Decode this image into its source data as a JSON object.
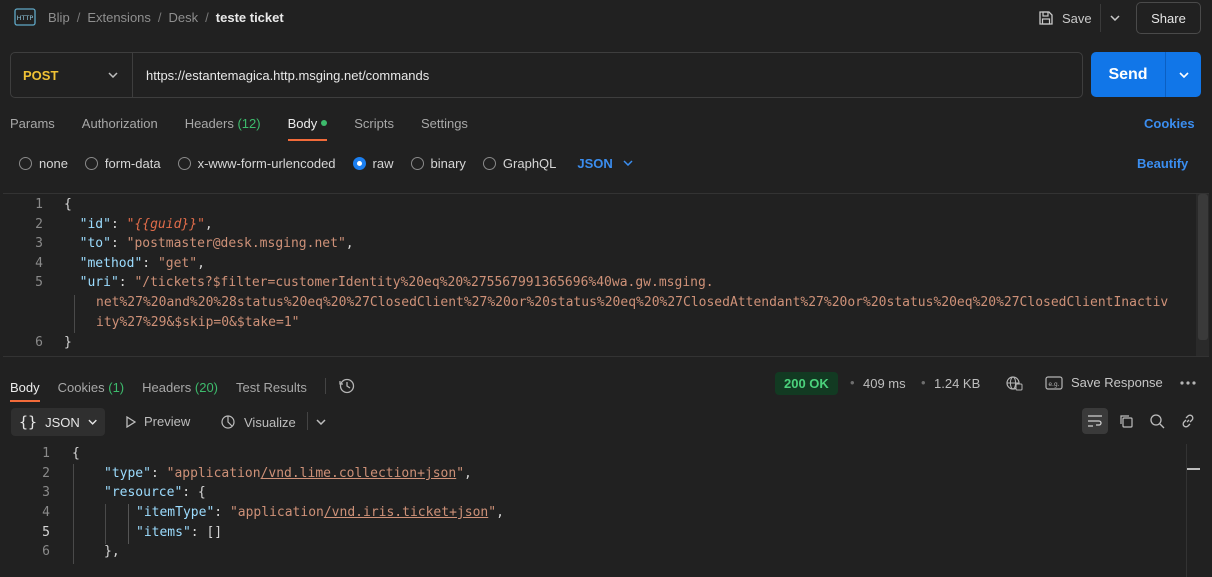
{
  "header": {
    "breadcrumbs": [
      "Blip",
      "Extensions",
      "Desk"
    ],
    "current": "teste ticket",
    "save_label": "Save",
    "share_label": "Share"
  },
  "request": {
    "method": "POST",
    "url": "https://estantemagica.http.msging.net/commands",
    "send_label": "Send"
  },
  "req_tabs": [
    {
      "label": "Params"
    },
    {
      "label": "Authorization"
    },
    {
      "label": "Headers",
      "count": "(12)"
    },
    {
      "label": "Body",
      "active": true
    },
    {
      "label": "Scripts"
    },
    {
      "label": "Settings"
    }
  ],
  "cookies_link": "Cookies",
  "body_types": {
    "none": "none",
    "form_data": "form-data",
    "urlencoded": "x-www-form-urlencoded",
    "raw": "raw",
    "binary": "binary",
    "graphql": "GraphQL",
    "format": "JSON",
    "selected": "raw"
  },
  "beautify_label": "Beautify",
  "request_body": {
    "line_numbers": [
      "1",
      "2",
      "3",
      "4",
      "5",
      "6"
    ],
    "open_brace": "{",
    "close_brace": "}",
    "id_key": "\"id\"",
    "id_value": "\"{{guid}}\"",
    "to_key": "\"to\"",
    "to_value": "\"postmaster@desk.msging.net\"",
    "method_key": "\"method\"",
    "method_value": "\"get\"",
    "uri_key": "\"uri\"",
    "uri_value_1": "\"/tickets?$filter=customerIdentity%20eq%20%275567991365696%40wa.gw.msging.",
    "uri_value_2": "net%27%20and%20%28status%20eq%20%27ClosedClient%27%20or%20status%20eq%20%27ClosedAttendant%27%20or%20status%20eq%20%27ClosedClientInactiv",
    "uri_value_3": "ity%27%29&$skip=0&$take=1\""
  },
  "res_tabs": {
    "body": "Body",
    "cookies": "Cookies",
    "cookies_count": "(1)",
    "headers": "Headers",
    "headers_count": "(20)",
    "test_results": "Test Results"
  },
  "response_meta": {
    "status": "200 OK",
    "time": "409 ms",
    "size": "1.24 KB",
    "save_response": "Save Response"
  },
  "response_toolbar": {
    "format": "JSON",
    "preview": "Preview",
    "visualize": "Visualize"
  },
  "response_body": {
    "line_numbers": [
      "1",
      "2",
      "3",
      "4",
      "5",
      "6"
    ],
    "open_brace": "{",
    "type_key": "\"type\"",
    "type_value_a": "\"application",
    "type_value_b": "/vnd.lime.collection+json",
    "type_value_c": "\"",
    "resource_key": "\"resource\"",
    "item_type_key": "\"itemType\"",
    "item_type_value_a": "\"application",
    "item_type_value_b": "/vnd.iris.ticket+json",
    "item_type_value_c": "\"",
    "items_key": "\"items\"",
    "items_value": "[]",
    "close_resource": "},"
  },
  "colors": {
    "accent_blue": "#1176e8",
    "method_yellow": "#f0c235",
    "active_tab": "#f26b3a",
    "status_green": "#4bd27c"
  }
}
